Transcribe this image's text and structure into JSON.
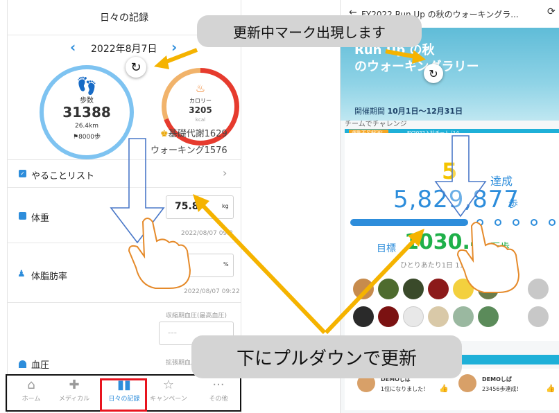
{
  "left": {
    "title": "日々の記録",
    "date": "2022年8月7日",
    "steps": {
      "label": "歩数",
      "value": "31388",
      "distance_value": "26.4",
      "distance_unit": "km",
      "goal": "8000歩"
    },
    "calories": {
      "label": "カロリー",
      "value": "3205",
      "unit": "kcal"
    },
    "basal": "基礎代謝1629",
    "walking": "ウォーキング1576",
    "todo_label": "やることリスト",
    "weight": {
      "label": "体重",
      "value": "75.8",
      "unit": "kg",
      "timestamp": "2022/08/07 09:2"
    },
    "bodyfat": {
      "label": "体脂肪率",
      "unit": "%",
      "timestamp": "2022/08/07 09:22"
    },
    "bp": {
      "label": "血圧",
      "systolic_label": "収縮期血圧(最高血圧)",
      "diastolic_label": "拡張期血圧",
      "placeholder": "---"
    },
    "tabs": [
      "ホーム",
      "メディカル",
      "日々の記録",
      "キャンペーン",
      "その他"
    ]
  },
  "right": {
    "header_title": "FY2022 Run Up の秋のウォーキングラ...",
    "banner_title_line1": "Run Up の秋",
    "banner_title_line2": "のウォーキングラリー",
    "period_label": "開催期間",
    "period": "10月1日〜12月31日",
    "challenge_label": "チームでチャレンジ",
    "badge": "運動不足解消！",
    "team_name": "FY2022入社チーム (14...",
    "percent": "5",
    "percent_suffix": "達成",
    "steps_total": "5,829,877",
    "steps_unit": "歩",
    "goal_label": "目標",
    "goal_value": "1030.4",
    "goal_unit": "万歩",
    "per_person": "ひとりあたり1日 11,83",
    "feed": [
      {
        "name": "DEMOしば",
        "message": "1位になりました！"
      },
      {
        "name": "DEMOしば",
        "message": "23456歩達成！"
      }
    ]
  },
  "callouts": {
    "top": "更新中マーク出現します",
    "bottom": "下にプルダウンで更新"
  },
  "colors": {
    "accent_blue": "#2d8ddb",
    "steps_ring": "#7ec3f1",
    "calorie_red": "#e63b2e",
    "calorie_orange": "#f1b36b",
    "arrow_yellow": "#f5b300",
    "highlight_red": "#e8141e",
    "teal": "#1fb0d8"
  }
}
